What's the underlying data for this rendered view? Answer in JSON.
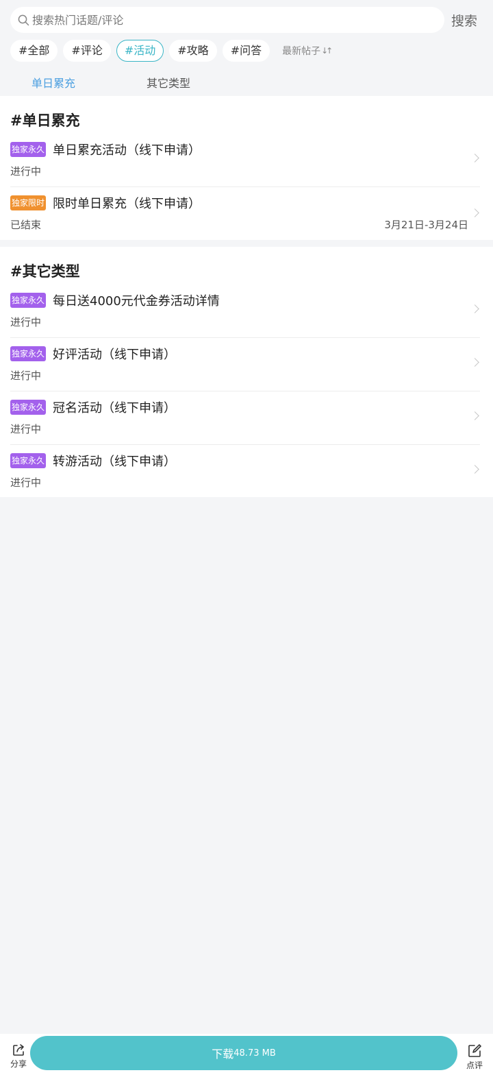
{
  "search": {
    "placeholder": "搜索热门话题/评论",
    "button_label": "搜索"
  },
  "tags": [
    {
      "label": "#全部",
      "active": false
    },
    {
      "label": "#评论",
      "active": false
    },
    {
      "label": "#活动",
      "active": true
    },
    {
      "label": "#攻略",
      "active": false
    },
    {
      "label": "#问答",
      "active": false
    }
  ],
  "sort": {
    "label": "最新帖子",
    "icon": "sort-arrows-icon"
  },
  "subtabs": [
    {
      "label": "单日累充",
      "active": true
    },
    {
      "label": "其它类型",
      "active": false
    }
  ],
  "sections": [
    {
      "title": "#单日累充",
      "items": [
        {
          "badge": "独家永久",
          "badge_color": "#a361ec",
          "title": "单日累充活动（线下申请）",
          "status": "进行中",
          "date": ""
        },
        {
          "badge": "独家限时",
          "badge_color": "#f0912f",
          "title": "限时单日累充（线下申请）",
          "status": "已结束",
          "date": "3月21日-3月24日"
        }
      ]
    },
    {
      "title": "#其它类型",
      "items": [
        {
          "badge": "独家永久",
          "badge_color": "#a361ec",
          "title": "每日送4000元代金券活动详情",
          "status": "进行中",
          "date": ""
        },
        {
          "badge": "独家永久",
          "badge_color": "#a361ec",
          "title": "好评活动（线下申请）",
          "status": "进行中",
          "date": ""
        },
        {
          "badge": "独家永久",
          "badge_color": "#a361ec",
          "title": "冠名活动（线下申请）",
          "status": "进行中",
          "date": ""
        },
        {
          "badge": "独家永久",
          "badge_color": "#a361ec",
          "title": "转游活动（线下申请）",
          "status": "进行中",
          "date": ""
        }
      ]
    }
  ],
  "bottom_bar": {
    "share_label": "分享",
    "review_label": "点评",
    "download_label": "下载",
    "download_size": "48.73 MB",
    "accent_color": "#52c3cb"
  }
}
